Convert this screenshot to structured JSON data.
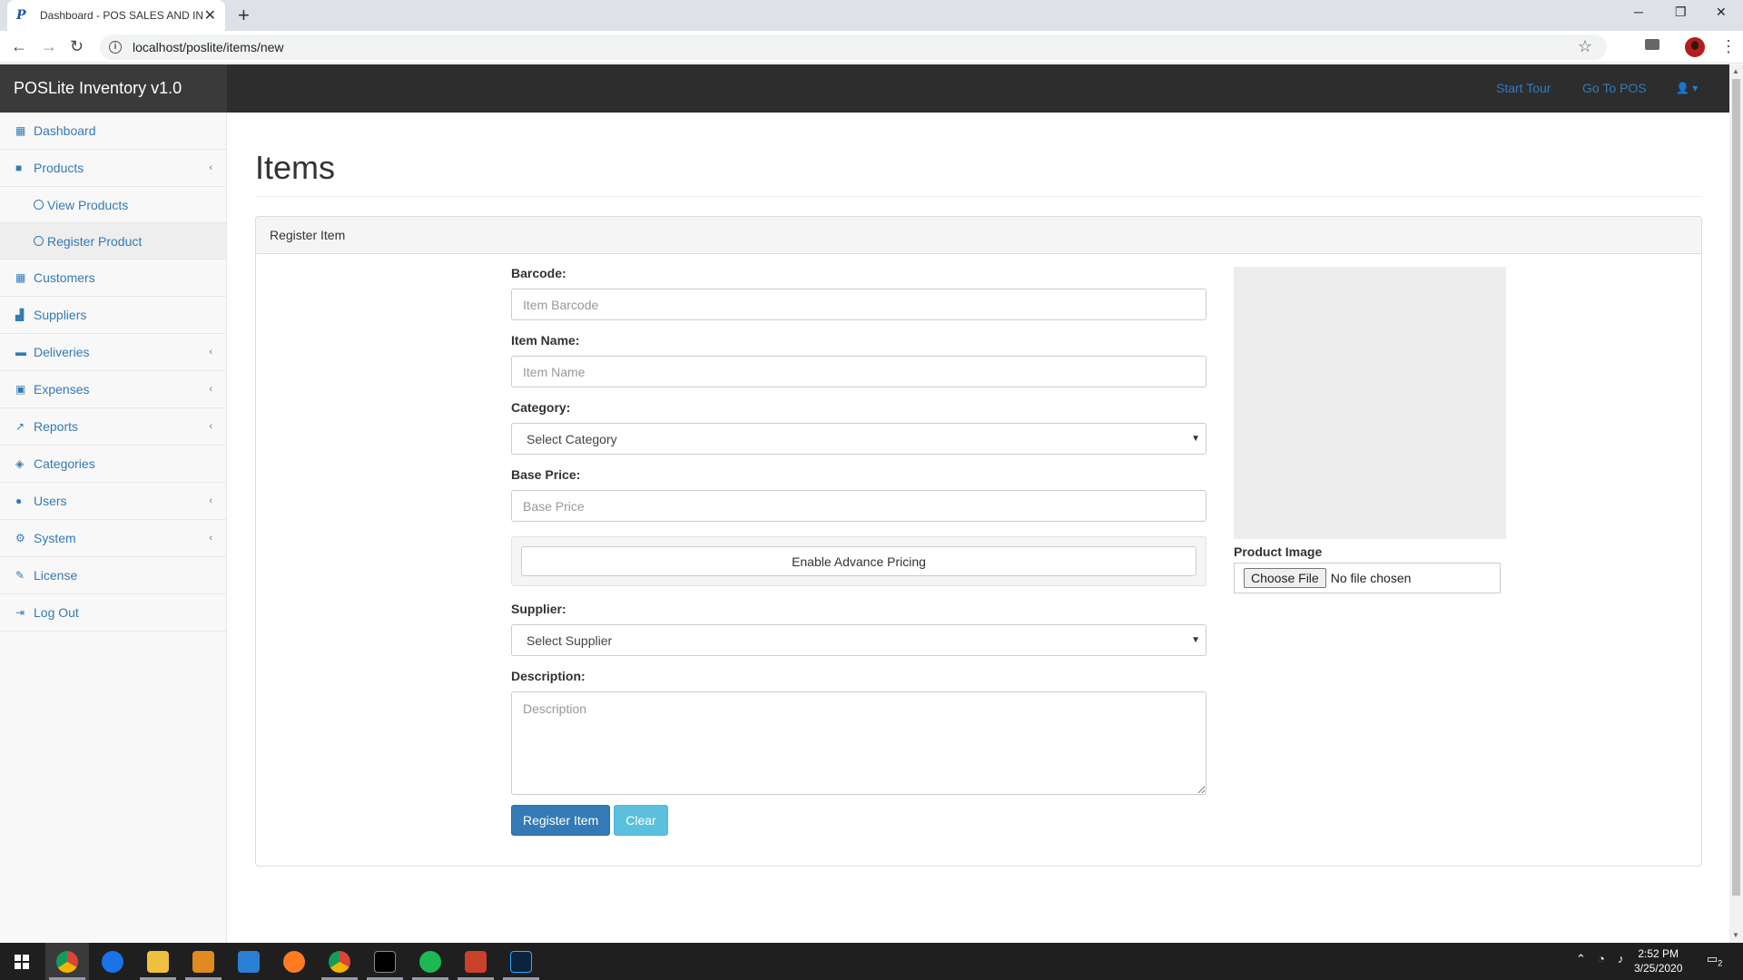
{
  "browser": {
    "tab_title": "Dashboard - POS SALES AND IN",
    "tab_favicon": "P",
    "url": "localhost/poslite/items/new"
  },
  "header": {
    "brand": "POSLite Inventory v1.0",
    "start_tour": "Start Tour",
    "go_to_pos": "Go To POS"
  },
  "sidebar": {
    "items": [
      {
        "label": "Dashboard",
        "icon": "table-icon"
      },
      {
        "label": "Products",
        "icon": "folder-icon"
      },
      {
        "label": "View Products",
        "icon": "circle-icon"
      },
      {
        "label": "Register Product",
        "icon": "circle-icon"
      },
      {
        "label": "Customers",
        "icon": "table-icon"
      },
      {
        "label": "Suppliers",
        "icon": "bar-chart-icon"
      },
      {
        "label": "Deliveries",
        "icon": "truck-icon"
      },
      {
        "label": "Expenses",
        "icon": "money-icon"
      },
      {
        "label": "Reports",
        "icon": "line-chart-icon"
      },
      {
        "label": "Categories",
        "icon": "tags-icon"
      },
      {
        "label": "Users",
        "icon": "users-icon"
      },
      {
        "label": "System",
        "icon": "gear-icon"
      },
      {
        "label": "License",
        "icon": "wrench-icon"
      },
      {
        "label": "Log Out",
        "icon": "sign-out-icon"
      }
    ]
  },
  "main": {
    "title": "Items",
    "panel_heading": "Register Item",
    "form": {
      "barcode_label": "Barcode:",
      "barcode_placeholder": "Item Barcode",
      "item_name_label": "Item Name:",
      "item_name_placeholder": "Item Name",
      "category_label": "Category:",
      "category_selected": "Select Category",
      "base_price_label": "Base Price:",
      "base_price_placeholder": "Base Price",
      "advance_pricing": "Enable Advance Pricing",
      "supplier_label": "Supplier:",
      "supplier_selected": "Select Supplier",
      "description_label": "Description:",
      "description_placeholder": "Description",
      "register_button": "Register Item",
      "clear_button": "Clear"
    },
    "image": {
      "label": "Product Image",
      "choose_file": "Choose File",
      "file_status": "No file chosen"
    }
  },
  "taskbar": {
    "time": "2:52 PM",
    "date": "3/25/2020",
    "notifications": "2"
  },
  "colors": {
    "link": "#337ab7",
    "header_bg": "#2d2d2d",
    "primary": "#337ab7",
    "info": "#5bc0de"
  }
}
